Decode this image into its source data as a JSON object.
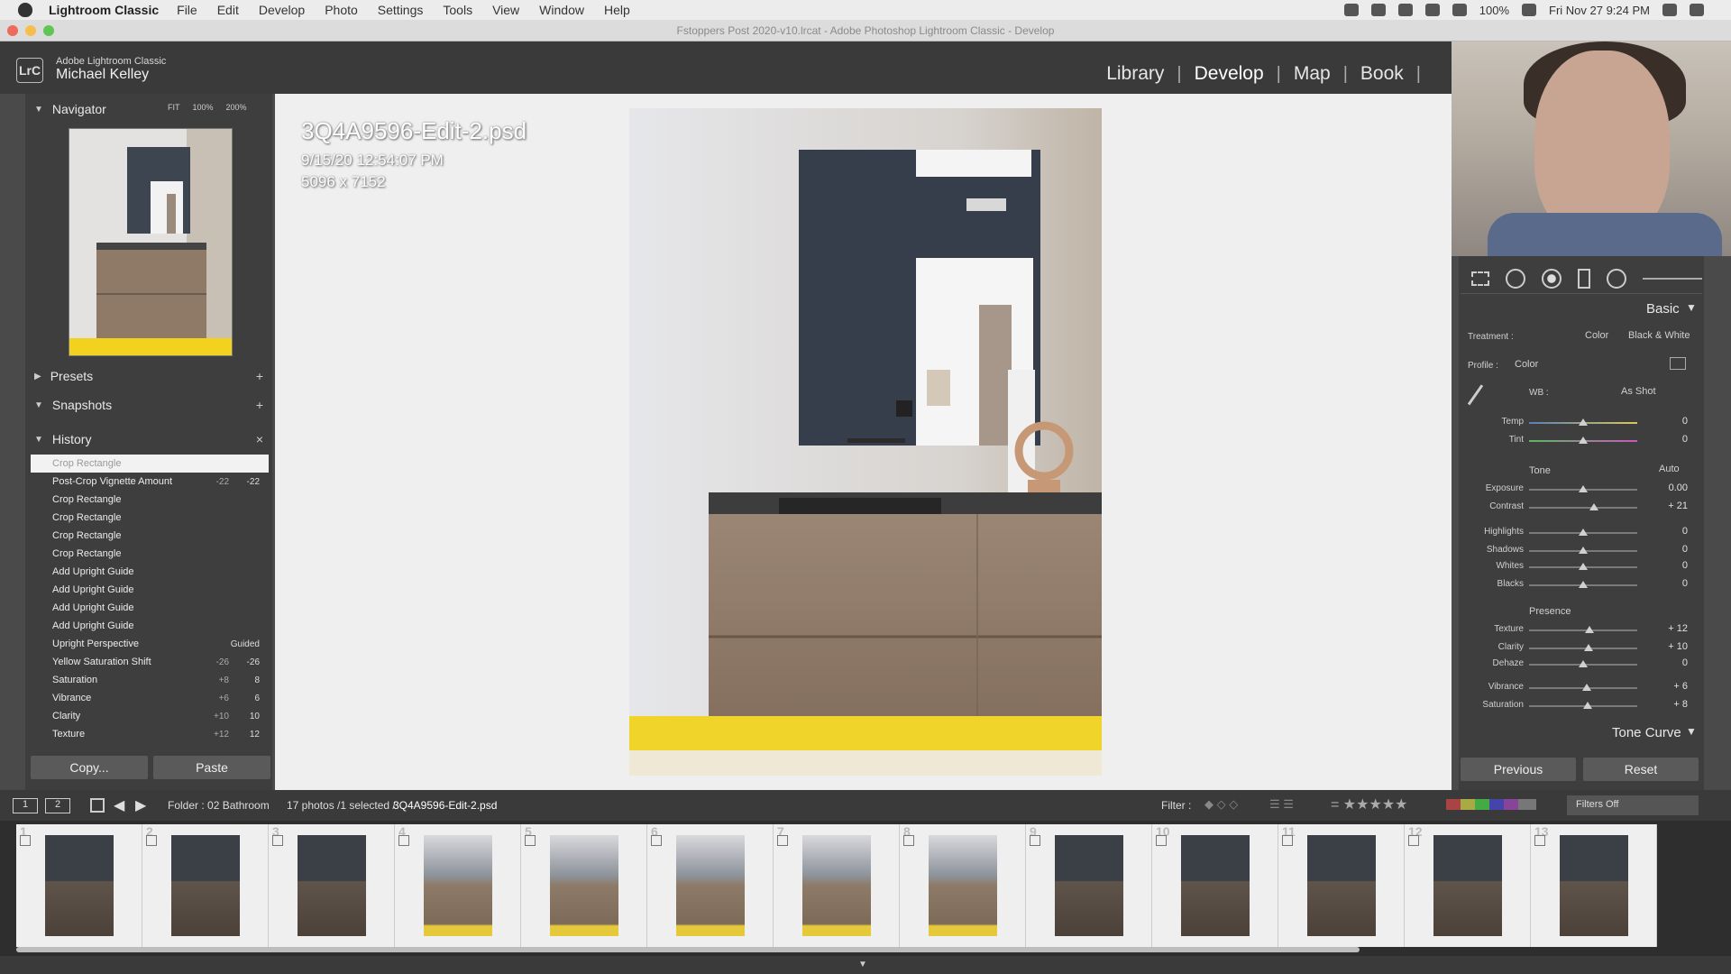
{
  "menubar": {
    "app": "Lightroom Classic",
    "items": [
      "File",
      "Edit",
      "Develop",
      "Photo",
      "Settings",
      "Tools",
      "View",
      "Window",
      "Help"
    ],
    "battery": "100%",
    "datetime": "Fri Nov 27  9:24 PM"
  },
  "window": {
    "title": "Fstoppers Post 2020-v10.lrcat - Adobe Photoshop Lightroom Classic - Develop"
  },
  "header": {
    "logo": "LrC",
    "product": "Adobe Lightroom Classic",
    "user": "Michael Kelley",
    "modules": [
      "Library",
      "Develop",
      "Map",
      "Book"
    ]
  },
  "left": {
    "navigator": {
      "title": "Navigator",
      "opts": [
        "FIT",
        "100%",
        "200%"
      ]
    },
    "presets": "Presets",
    "snapshots": "Snapshots",
    "history": {
      "title": "History",
      "items": [
        {
          "label": "Crop Rectangle",
          "v1": "",
          "v2": ""
        },
        {
          "label": "Post-Crop Vignette Amount",
          "v1": "-22",
          "v2": "-22"
        },
        {
          "label": "Crop Rectangle",
          "v1": "",
          "v2": ""
        },
        {
          "label": "Crop Rectangle",
          "v1": "",
          "v2": ""
        },
        {
          "label": "Crop Rectangle",
          "v1": "",
          "v2": ""
        },
        {
          "label": "Crop Rectangle",
          "v1": "",
          "v2": ""
        },
        {
          "label": "Add Upright Guide",
          "v1": "",
          "v2": ""
        },
        {
          "label": "Add Upright Guide",
          "v1": "",
          "v2": ""
        },
        {
          "label": "Add Upright Guide",
          "v1": "",
          "v2": ""
        },
        {
          "label": "Add Upright Guide",
          "v1": "",
          "v2": ""
        },
        {
          "label": "Upright Perspective",
          "v1": "",
          "v2": "Guided"
        },
        {
          "label": "Yellow Saturation Shift",
          "v1": "-26",
          "v2": "-26"
        },
        {
          "label": "Saturation",
          "v1": "+8",
          "v2": "8"
        },
        {
          "label": "Vibrance",
          "v1": "+6",
          "v2": "6"
        },
        {
          "label": "Clarity",
          "v1": "+10",
          "v2": "10"
        },
        {
          "label": "Texture",
          "v1": "+12",
          "v2": "12"
        }
      ]
    },
    "copy": "Copy...",
    "paste": "Paste"
  },
  "image": {
    "name": "3Q4A9596-Edit-2.psd",
    "date": "9/15/20 12:54:07 PM",
    "dims": "5096 x 7152"
  },
  "right": {
    "basic": "Basic",
    "treatment_label": "Treatment :",
    "treatment_color": "Color",
    "treatment_bw": "Black & White",
    "profile_label": "Profile :",
    "profile_value": "Color",
    "wb_label": "WB :",
    "wb_value": "As Shot",
    "tone_label": "Tone",
    "auto": "Auto",
    "presence_label": "Presence",
    "sliders": [
      {
        "name": "Temp",
        "value": "0",
        "pos": 0.5
      },
      {
        "name": "Tint",
        "value": "0",
        "pos": 0.5
      },
      {
        "name": "Exposure",
        "value": "0.00",
        "pos": 0.5
      },
      {
        "name": "Contrast",
        "value": "+ 21",
        "pos": 0.6
      },
      {
        "name": "Highlights",
        "value": "0",
        "pos": 0.5
      },
      {
        "name": "Shadows",
        "value": "0",
        "pos": 0.5
      },
      {
        "name": "Whites",
        "value": "0",
        "pos": 0.5
      },
      {
        "name": "Blacks",
        "value": "0",
        "pos": 0.5
      },
      {
        "name": "Texture",
        "value": "+ 12",
        "pos": 0.56
      },
      {
        "name": "Clarity",
        "value": "+ 10",
        "pos": 0.55
      },
      {
        "name": "Dehaze",
        "value": "0",
        "pos": 0.5
      },
      {
        "name": "Vibrance",
        "value": "+ 6",
        "pos": 0.53
      },
      {
        "name": "Saturation",
        "value": "+ 8",
        "pos": 0.54
      }
    ],
    "tone_curve": "Tone Curve",
    "previous": "Previous",
    "reset": "Reset"
  },
  "filmstrip": {
    "view1": "1",
    "view2": "2",
    "folder": "Folder : 02 Bathroom",
    "count": "17 photos /1 selected /",
    "selected": "3Q4A9596-Edit-2.psd",
    "filter_label": "Filter :",
    "filters_off": "Filters Off",
    "thumbs": [
      "1",
      "2",
      "3",
      "4",
      "5",
      "6",
      "7",
      "8",
      "9",
      "10",
      "11",
      "12",
      "13"
    ]
  }
}
